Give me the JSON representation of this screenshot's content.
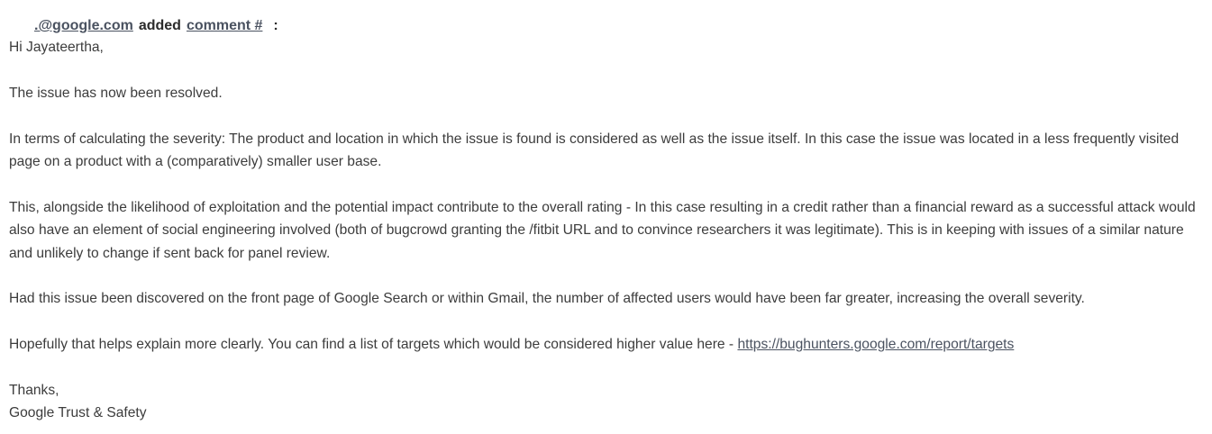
{
  "comment": {
    "author": ".@google.com",
    "action": "added",
    "comment_link": "comment #",
    "colon": ":",
    "greeting": "Hi Jayateertha,",
    "p1": "The issue has now been resolved.",
    "p2": "In terms of calculating the severity: The product and location in which the issue is found is considered as well as the issue itself. In this case the issue was located in a less frequently visited page on a product with a (comparatively) smaller user base.",
    "p3": "This, alongside the likelihood of exploitation and the potential impact contribute to the overall rating - In this case resulting in a credit rather than a financial reward as a successful attack would also have an element of social engineering involved (both of bugcrowd granting the /fitbit URL and to convince researchers it was legitimate). This is in keeping with issues of a similar nature and unlikely to change if sent back for panel review.",
    "p4": "Had this issue been discovered on the front page of Google Search or within Gmail, the number of affected users would have been far greater, increasing the overall severity.",
    "p5_text": "Hopefully that helps explain more clearly. You can find a list of targets which would be considered higher value here - ",
    "p5_link": "https://bughunters.google.com/report/targets",
    "signoff": "Thanks,",
    "signature": "Google Trust & Safety"
  }
}
